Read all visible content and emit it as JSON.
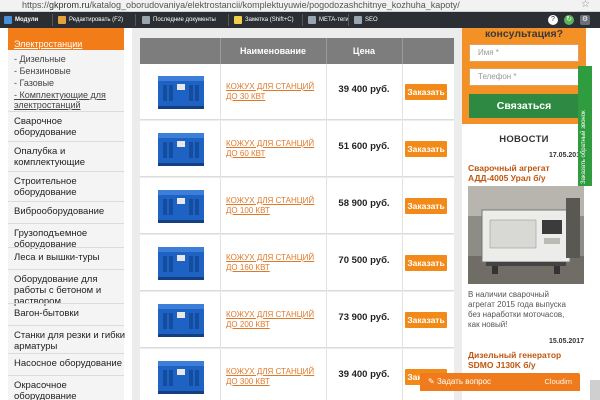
{
  "browser": {
    "url_scheme": "https://",
    "url_host": "gkprom.ru",
    "url_path": "/katalog_oborudovaniya/elektrostancii/komplektuyuwie/pogodozashchitnye_kozhuha_kapoty/"
  },
  "adminbar": {
    "items": [
      "Модули",
      "Редактировать (F2)",
      "Последние документы",
      "Заметка (Shift+C)",
      "META-теги",
      "SEO"
    ]
  },
  "sidebar": {
    "active": "Электростанции",
    "sub_items": [
      "- Дизельные",
      "- Бензиновые",
      "- Газовые",
      "- Комплектующие для",
      "электростанций"
    ],
    "categories": [
      [
        "Сварочное",
        "оборудование"
      ],
      [
        "Опалубка и",
        "комплектующие"
      ],
      [
        "Строительное",
        "оборудование"
      ],
      [
        "Виброоборудование"
      ],
      [
        "Грузоподъемное",
        "оборудование"
      ],
      [
        "Леса и вышки-туры"
      ],
      [
        "Оборудование для",
        "работы с бетоном и",
        "раствором"
      ],
      [
        "Вагон-бытовки"
      ],
      [
        "Станки для резки и гибки",
        "арматуры"
      ],
      [
        "Насосное оборудование"
      ],
      [
        "Окрасочное",
        "оборудование"
      ]
    ]
  },
  "table": {
    "headers": [
      "Наименование",
      "Цена"
    ],
    "order_label": "Заказать",
    "rows": [
      {
        "name_1": "КОЖУХ ДЛЯ СТАНЦИЙ",
        "name_2": "ДО 30 КВТ",
        "price": "39 400 руб."
      },
      {
        "name_1": "КОЖУХ ДЛЯ СТАНЦИЙ",
        "name_2": "ДО 60 КВТ",
        "price": "51 600 руб."
      },
      {
        "name_1": "КОЖУХ ДЛЯ СТАНЦИЙ",
        "name_2": "ДО 100 КВТ",
        "price": "58 900 руб."
      },
      {
        "name_1": "КОЖУХ ДЛЯ СТАНЦИЙ",
        "name_2": "ДО 160 КВТ",
        "price": "70 500 руб."
      },
      {
        "name_1": "КОЖУХ ДЛЯ СТАНЦИЙ",
        "name_2": "ДО 200 КВТ",
        "price": "73 900 руб."
      },
      {
        "name_1": "КОЖУХ ДЛЯ СТАНЦИЙ",
        "name_2": "ДО 300 КВТ",
        "price": "39 400 руб."
      }
    ]
  },
  "right": {
    "consult_title": "консультация?",
    "name_placeholder": "Имя *",
    "phone_placeholder": "Телефон *",
    "send_label": "Связаться",
    "news_title": "НОВОСТИ",
    "news": [
      {
        "date": "17.05.2017",
        "title_1": "Сварочный агрегат",
        "title_2": "АДД-4005 Урал б/у"
      },
      {
        "date": "15.05.2017",
        "title_1": "Дизельный генератор",
        "title_2": "SDMO J130K б/у"
      }
    ],
    "news_text": [
      "В наличии сварочный",
      "агрегат 2015 года выпуска",
      "без наработки моточасов,",
      "как новый!"
    ],
    "callback_tab": "Заказать обратный звонок"
  },
  "chat": {
    "label": "Задать вопрос",
    "brand": "Cloudim"
  },
  "colors": {
    "accent": "#f27d18",
    "green": "#2e8a43",
    "header": "#7d7d7d",
    "genset": "#1e63c4"
  }
}
